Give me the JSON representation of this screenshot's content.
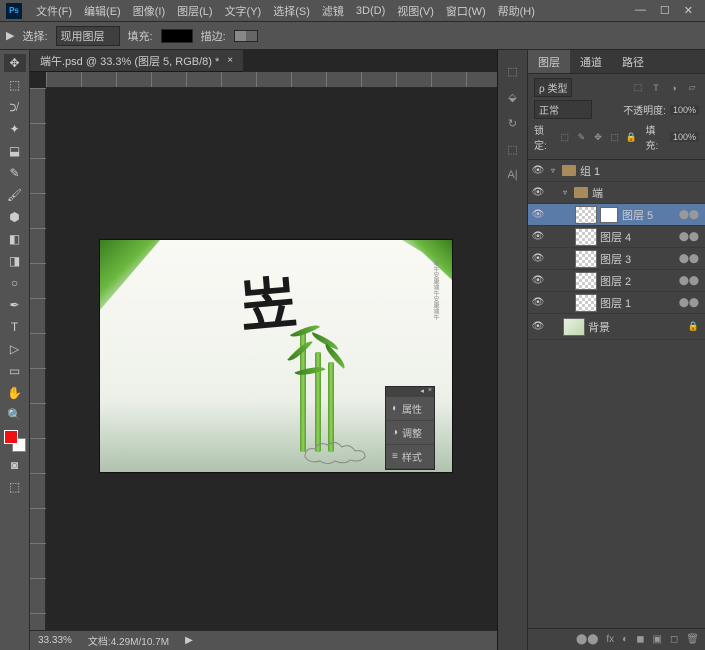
{
  "app": {
    "logo": "Ps"
  },
  "menu": [
    "文件(F)",
    "编辑(E)",
    "图像(I)",
    "图层(L)",
    "文字(Y)",
    "选择(S)",
    "滤镜",
    "3D(D)",
    "视图(V)",
    "窗口(W)",
    "帮助(H)"
  ],
  "optbar": {
    "arrow": "▶",
    "sel_label": "选择:",
    "sel_value": "现用图层",
    "fill_label": "填充:",
    "stroke_label": "描边:"
  },
  "tab": {
    "title": "端午.psd @ 33.3% (图层 5, RGB/8) *",
    "close": "×"
  },
  "status": {
    "zoom": "33.33%",
    "doc": "文档:4.29M/10.7M",
    "arrow": "▶"
  },
  "canvas": {
    "callig": "岦",
    "vtext": "端午安康端午安康端午"
  },
  "context": {
    "items": [
      {
        "icon": "◐",
        "label": "属性"
      },
      {
        "icon": "◑",
        "label": "调整"
      },
      {
        "icon": "≡",
        "label": "样式"
      }
    ]
  },
  "panel_strip": [
    "⬚",
    "⬙",
    "↻",
    "⬚",
    "A|"
  ],
  "panel": {
    "tabs": [
      "图层",
      "通道",
      "路径"
    ],
    "kind_label": "ρ 类型",
    "kind_icons": [
      "⬚",
      "T",
      "◑",
      "▱"
    ],
    "blend": "正常",
    "opacity_label": "不透明度:",
    "opacity_val": "100%",
    "lock_label": "锁定:",
    "lock_icons": [
      "⬚",
      "✎",
      "✥",
      "⬚",
      "🔒"
    ],
    "fill_label": "填充:",
    "fill_val": "100%",
    "layers": [
      {
        "type": "group",
        "indent": 0,
        "name": "组 1",
        "open": true
      },
      {
        "type": "group",
        "indent": 1,
        "name": "端",
        "open": true
      },
      {
        "type": "layer",
        "indent": 2,
        "name": "图层 5",
        "sel": true,
        "mask": true,
        "link": "⬤⬤"
      },
      {
        "type": "layer",
        "indent": 2,
        "name": "图层 4",
        "link": "⬤⬤"
      },
      {
        "type": "layer",
        "indent": 2,
        "name": "图层 3",
        "link": "⬤⬤"
      },
      {
        "type": "layer",
        "indent": 2,
        "name": "图层 2",
        "link": "⬤⬤"
      },
      {
        "type": "layer",
        "indent": 2,
        "name": "图层 1",
        "link": "⬤⬤"
      },
      {
        "type": "bg",
        "indent": 1,
        "name": "背景",
        "lock": "🔒"
      }
    ],
    "foot": [
      "⬤⬤",
      "fx",
      "◐",
      "◼",
      "▣",
      "◻",
      "🗑"
    ]
  }
}
